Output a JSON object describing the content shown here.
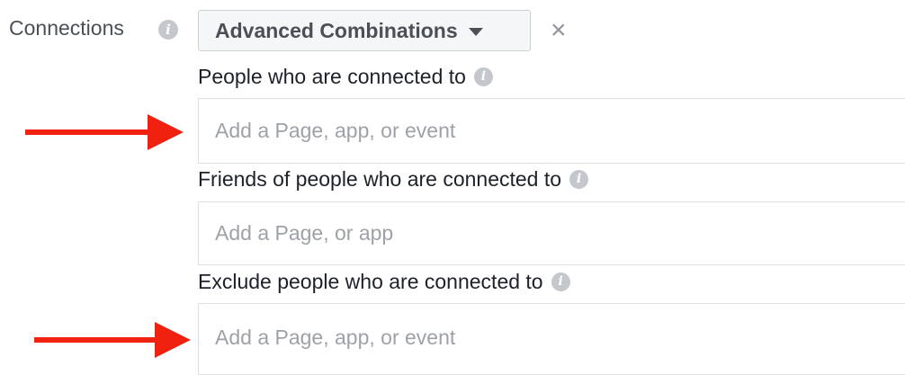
{
  "connections": {
    "label": "Connections",
    "info_icon_glyph": "i",
    "dropdown_value": "Advanced Combinations",
    "close_glyph": "×"
  },
  "sections": [
    {
      "label": "People who are connected to",
      "placeholder": "Add a Page, app, or event",
      "value": ""
    },
    {
      "label": "Friends of people who are connected to",
      "placeholder": "Add a Page, or app",
      "value": ""
    },
    {
      "label": "Exclude people who are connected to",
      "placeholder": "Add a Page, app, or event",
      "value": ""
    }
  ],
  "annotations": {
    "arrow_color": "#f0220f",
    "arrow_targets": [
      "People who are connected to",
      "Exclude people who are connected to"
    ]
  },
  "icons": [
    "info-icon",
    "caret-down-icon",
    "close-icon",
    "red-arrow-icon"
  ]
}
